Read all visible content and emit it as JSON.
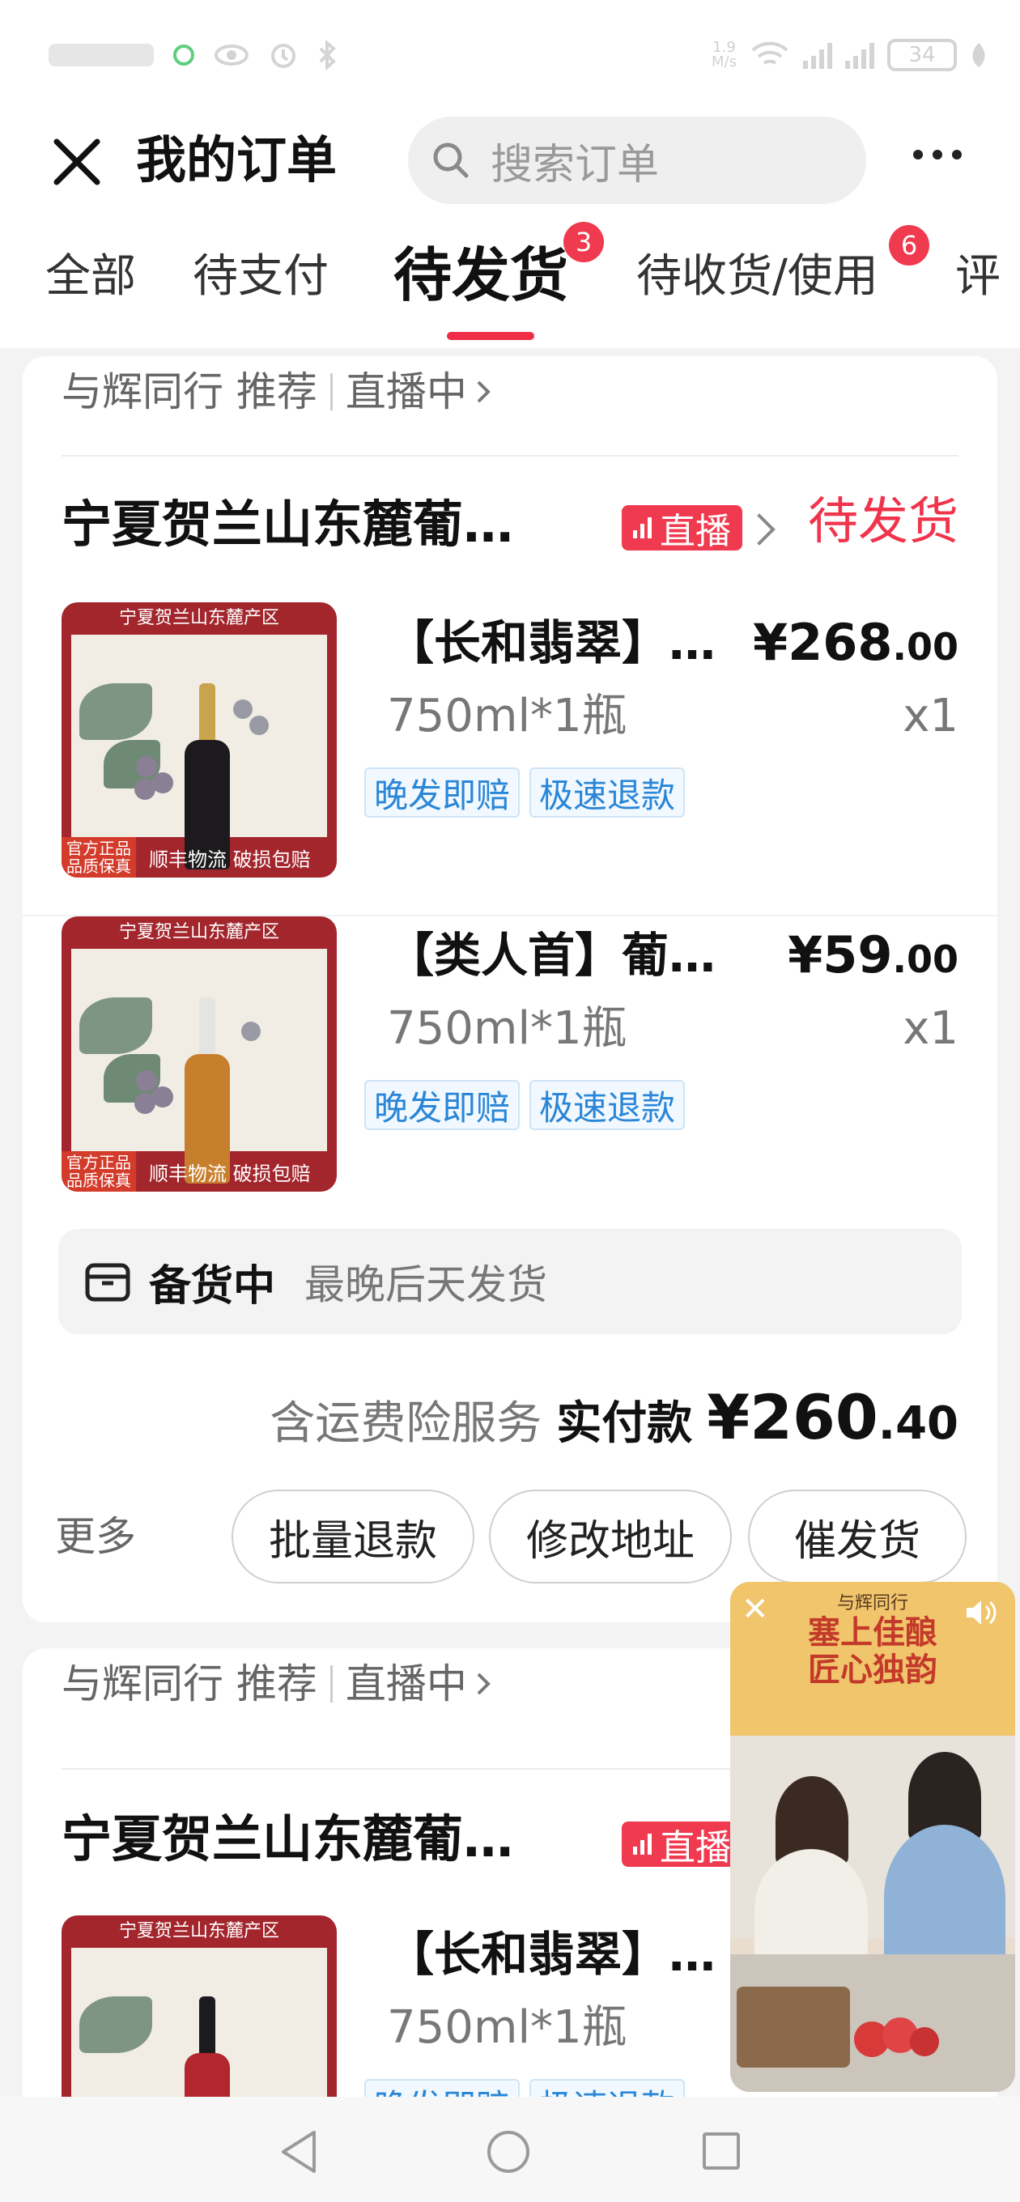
{
  "status_bar": {
    "net_speed": "1.9\nM/s",
    "battery": "34"
  },
  "header": {
    "title": "我的订单",
    "search_placeholder": "搜索订单"
  },
  "tabs": [
    {
      "label": "全部"
    },
    {
      "label": "待支付"
    },
    {
      "label": "待发货",
      "badge": "3",
      "active": true
    },
    {
      "label": "待收货/使用",
      "badge": "6"
    },
    {
      "label": "评"
    }
  ],
  "orders": [
    {
      "promo": {
        "source": "与辉同行 推荐",
        "live": "直播中"
      },
      "shop_name": "宁夏贺兰山东麓葡…",
      "live_tag": "直播",
      "status": "待发货",
      "products": [
        {
          "name": "【长和翡翠】…",
          "price_int": "¥268",
          "price_dec": ".00",
          "spec": "750ml*1瓶",
          "qty": "x1",
          "tags": [
            "晚发即赔",
            "极速退款"
          ]
        },
        {
          "name": "【类人首】葡…",
          "price_int": "¥59",
          "price_dec": ".00",
          "spec": "750ml*1瓶",
          "qty": "x1",
          "tags": [
            "晚发即赔",
            "极速退款"
          ]
        }
      ],
      "shipping": {
        "label": "备货中",
        "desc": "最晚后天发货"
      },
      "total": {
        "service": "含运费险服务",
        "label": "实付款",
        "amount_int": "¥260",
        "amount_dec": ".40"
      },
      "actions": {
        "more": "更多",
        "buttons": [
          "批量退款",
          "修改地址",
          "催发货"
        ]
      }
    },
    {
      "promo": {
        "source": "与辉同行 推荐",
        "live": "直播中"
      },
      "shop_name": "宁夏贺兰山东麓葡…",
      "live_tag": "直播",
      "products": [
        {
          "name": "【长和翡翠】…",
          "spec": "750ml*1瓶",
          "tags": [
            "晚发即赔",
            "极速退款"
          ]
        }
      ]
    }
  ],
  "product_image": {
    "banner": "宁夏贺兰山东麓产区",
    "badge_line1": "官方正品",
    "badge_line2": "品质保真",
    "footer": "顺丰物流 破损包赔"
  },
  "live_video": {
    "brand": "与辉同行",
    "headline_line1": "塞上佳酿",
    "headline_line2": "匠心独韵"
  },
  "colors": {
    "accent": "#f03a4f",
    "tag_blue": "#2a86d6"
  }
}
